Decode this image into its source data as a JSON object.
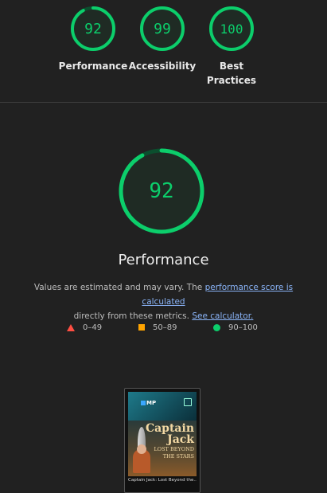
{
  "summary": {
    "categories": [
      {
        "score": "92",
        "label_line1": "Performance",
        "label_line2": ""
      },
      {
        "score": "99",
        "label_line1": "Accessibility",
        "label_line2": ""
      },
      {
        "score": "100",
        "label_line1": "Best",
        "label_line2": "Practices"
      }
    ]
  },
  "performance": {
    "score": "92",
    "score_fraction": 0.92,
    "title": "Performance",
    "description_part1": "Values are estimated and may vary. The ",
    "description_link1": "performance score is calculated",
    "description_part2": "directly from these metrics. ",
    "description_link2": "See calculator."
  },
  "legend": {
    "fail": "0–49",
    "average": "50–89",
    "pass": "90–100"
  },
  "screenshot": {
    "logo_text": "MP",
    "poster_title_line1": "Captain",
    "poster_title_line2": "Jack",
    "poster_subtitle_line1": "LOST BEYOND",
    "poster_subtitle_line2": "THE STARS",
    "caption": "Captain Jack: Lost Beyond the..."
  },
  "colors": {
    "pass": "#0cce6b",
    "average": "#ffa400",
    "fail": "#ff4e42",
    "background": "#212121",
    "link": "#8ab4f8"
  },
  "icons": {
    "fail": "red-triangle-icon",
    "average": "orange-square-icon",
    "pass": "green-circle-icon"
  }
}
